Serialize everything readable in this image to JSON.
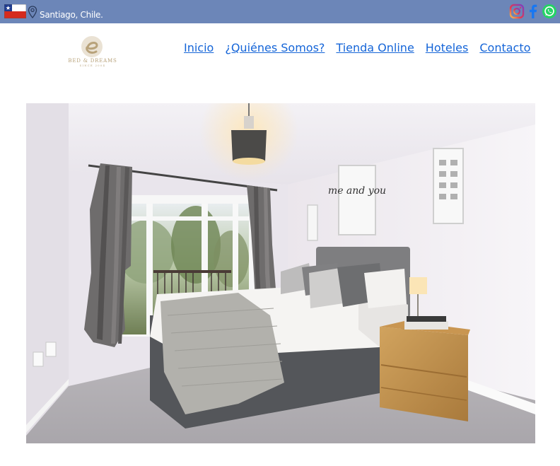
{
  "topbar": {
    "location": "Santiago, Chile.",
    "flag_icon": "chile-flag-icon",
    "location_icon": "map-pin-icon",
    "social": [
      "instagram-icon",
      "facebook-icon",
      "whatsapp-icon"
    ]
  },
  "logo": {
    "icon": "bed-dreams-logo",
    "wordmark": "BED & DREAMS",
    "tagline": "SINCE 2004"
  },
  "nav": {
    "items": [
      {
        "label": "Inicio"
      },
      {
        "label": "¿Quiénes Somos?"
      },
      {
        "label": "Tienda Online"
      },
      {
        "label": "Hoteles"
      },
      {
        "label": "Contacto"
      }
    ]
  },
  "hero": {
    "icon": "bedroom-photo",
    "poster_text": "me and you"
  },
  "colors": {
    "topbar": "#6c86b8",
    "link": "#1565d8",
    "logo_gold": "#b8a27a"
  }
}
